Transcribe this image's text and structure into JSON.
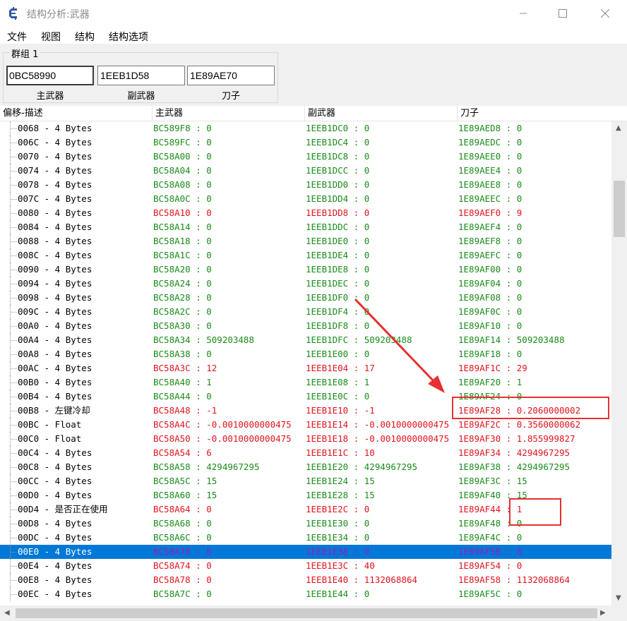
{
  "window": {
    "title": "结构分析:武器"
  },
  "menu": [
    "文件",
    "视图",
    "结构",
    "结构选项"
  ],
  "group": {
    "title": "群组 1",
    "addresses": [
      {
        "value": "0BC58990",
        "label": "主武器"
      },
      {
        "value": "1EEB1D58",
        "label": "副武器"
      },
      {
        "value": "1E89AE70",
        "label": "刀子"
      }
    ]
  },
  "columns": [
    "偏移-描述",
    "主武器",
    "副武器",
    "刀子"
  ],
  "rows": [
    {
      "desc": "0068 - 4 Bytes",
      "c1": "BC589F8 : 0",
      "c2": "1EEB1DC0 : 0",
      "c3": "1E89AED8 : 0",
      "color": "g"
    },
    {
      "desc": "006C - 4 Bytes",
      "c1": "BC589FC : 0",
      "c2": "1EEB1DC4 : 0",
      "c3": "1E89AEDC : 0",
      "color": "g"
    },
    {
      "desc": "0070 - 4 Bytes",
      "c1": "BC58A00 : 0",
      "c2": "1EEB1DC8 : 0",
      "c3": "1E89AEE0 : 0",
      "color": "g"
    },
    {
      "desc": "0074 - 4 Bytes",
      "c1": "BC58A04 : 0",
      "c2": "1EEB1DCC : 0",
      "c3": "1E89AEE4 : 0",
      "color": "g"
    },
    {
      "desc": "0078 - 4 Bytes",
      "c1": "BC58A08 : 0",
      "c2": "1EEB1DD0 : 0",
      "c3": "1E89AEE8 : 0",
      "color": "g"
    },
    {
      "desc": "007C - 4 Bytes",
      "c1": "BC58A0C : 0",
      "c2": "1EEB1DD4 : 0",
      "c3": "1E89AEEC : 0",
      "color": "g"
    },
    {
      "desc": "0080 - 4 Bytes",
      "c1": "BC58A10 : 0",
      "c2": "1EEB1DD8 : 0",
      "c3": "1E89AEF0 : 9",
      "color": "r"
    },
    {
      "desc": "0084 - 4 Bytes",
      "c1": "BC58A14 : 0",
      "c2": "1EEB1DDC : 0",
      "c3": "1E89AEF4 : 0",
      "color": "g"
    },
    {
      "desc": "0088 - 4 Bytes",
      "c1": "BC58A18 : 0",
      "c2": "1EEB1DE0 : 0",
      "c3": "1E89AEF8 : 0",
      "color": "g"
    },
    {
      "desc": "008C - 4 Bytes",
      "c1": "BC58A1C : 0",
      "c2": "1EEB1DE4 : 0",
      "c3": "1E89AEFC : 0",
      "color": "g"
    },
    {
      "desc": "0090 - 4 Bytes",
      "c1": "BC58A20 : 0",
      "c2": "1EEB1DE8 : 0",
      "c3": "1E89AF00 : 0",
      "color": "g"
    },
    {
      "desc": "0094 - 4 Bytes",
      "c1": "BC58A24 : 0",
      "c2": "1EEB1DEC : 0",
      "c3": "1E89AF04 : 0",
      "color": "g"
    },
    {
      "desc": "0098 - 4 Bytes",
      "c1": "BC58A28 : 0",
      "c2": "1EEB1DF0 : 0",
      "c3": "1E89AF08 : 0",
      "color": "g"
    },
    {
      "desc": "009C - 4 Bytes",
      "c1": "BC58A2C : 0",
      "c2": "1EEB1DF4 : 0",
      "c3": "1E89AF0C : 0",
      "color": "g"
    },
    {
      "desc": "00A0 - 4 Bytes",
      "c1": "BC58A30 : 0",
      "c2": "1EEB1DF8 : 0",
      "c3": "1E89AF10 : 0",
      "color": "g"
    },
    {
      "desc": "00A4 - 4 Bytes",
      "c1": "BC58A34 : 509203488",
      "c2": "1EEB1DFC : 509203488",
      "c3": "1E89AF14 : 509203488",
      "color": "g"
    },
    {
      "desc": "00A8 - 4 Bytes",
      "c1": "BC58A38 : 0",
      "c2": "1EEB1E00 : 0",
      "c3": "1E89AF18 : 0",
      "color": "g"
    },
    {
      "desc": "00AC - 4 Bytes",
      "c1": "BC58A3C : 12",
      "c2": "1EEB1E04 : 17",
      "c3": "1E89AF1C : 29",
      "color": "r"
    },
    {
      "desc": "00B0 - 4 Bytes",
      "c1": "BC58A40 : 1",
      "c2": "1EEB1E08 : 1",
      "c3": "1E89AF20 : 1",
      "color": "g"
    },
    {
      "desc": "00B4 - 4 Bytes",
      "c1": "BC58A44 : 0",
      "c2": "1EEB1E0C : 0",
      "c3": "1E89AF24 : 0",
      "color": "g"
    },
    {
      "desc": "00B8 - 左键冷却",
      "c1": "BC58A48 : -1",
      "c2": "1EEB1E10 : -1",
      "c3": "1E89AF28 : 0.2060000002",
      "color": "r"
    },
    {
      "desc": "00BC - Float",
      "c1": "BC58A4C : -0.0010000000475",
      "c2": "1EEB1E14 : -0.0010000000475",
      "c3": "1E89AF2C : 0.3560000062",
      "color": "r"
    },
    {
      "desc": "00C0 - Float",
      "c1": "BC58A50 : -0.0010000000475",
      "c2": "1EEB1E18 : -0.0010000000475",
      "c3": "1E89AF30 : 1.855999827",
      "color": "r"
    },
    {
      "desc": "00C4 - 4 Bytes",
      "c1": "BC58A54 : 6",
      "c2": "1EEB1E1C : 10",
      "c3": "1E89AF34 : 4294967295",
      "color": "r"
    },
    {
      "desc": "00C8 - 4 Bytes",
      "c1": "BC58A58 : 4294967295",
      "c2": "1EEB1E20 : 4294967295",
      "c3": "1E89AF38 : 4294967295",
      "color": "g"
    },
    {
      "desc": "00CC - 4 Bytes",
      "c1": "BC58A5C : 15",
      "c2": "1EEB1E24 : 15",
      "c3": "1E89AF3C : 15",
      "color": "g"
    },
    {
      "desc": "00D0 - 4 Bytes",
      "c1": "BC58A60 : 15",
      "c2": "1EEB1E28 : 15",
      "c3": "1E89AF40 : 15",
      "color": "g"
    },
    {
      "desc": "00D4 - 是否正在使用",
      "c1": "BC58A64 : 0",
      "c2": "1EEB1E2C : 0",
      "c3": "1E89AF44 : 1",
      "color": "r"
    },
    {
      "desc": "00D8 - 4 Bytes",
      "c1": "BC58A68 : 0",
      "c2": "1EEB1E30 : 0",
      "c3": "1E89AF48 : 0",
      "color": "g"
    },
    {
      "desc": "00DC - 4 Bytes",
      "c1": "BC58A6C : 0",
      "c2": "1EEB1E34 : 0",
      "c3": "1E89AF4C : 0",
      "color": "g"
    },
    {
      "desc": "00E0 - 4 Bytes",
      "c1": "BC58A70 : 0",
      "c2": "1EEB1E38 : 0",
      "c3": "1E89AF50 : 0",
      "color": "sel"
    },
    {
      "desc": "00E4 - 4 Bytes",
      "c1": "BC58A74 : 0",
      "c2": "1EEB1E3C : 40",
      "c3": "1E89AF54 : 0",
      "color": "r"
    },
    {
      "desc": "00E8 - 4 Bytes",
      "c1": "BC58A78 : 0",
      "c2": "1EEB1E40 : 1132068864",
      "c3": "1E89AF58 : 1132068864",
      "color": "r"
    },
    {
      "desc": "00EC - 4 Bytes",
      "c1": "BC58A7C : 0",
      "c2": "1EEB1E44 : 0",
      "c3": "1E89AF5C : 0",
      "color": "g"
    }
  ]
}
